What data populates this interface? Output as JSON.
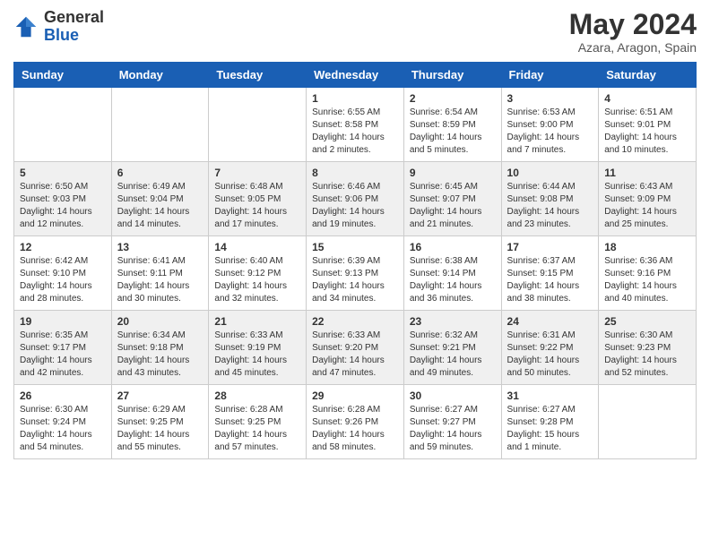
{
  "header": {
    "logo_general": "General",
    "logo_blue": "Blue",
    "month_year": "May 2024",
    "location": "Azara, Aragon, Spain"
  },
  "weekdays": [
    "Sunday",
    "Monday",
    "Tuesday",
    "Wednesday",
    "Thursday",
    "Friday",
    "Saturday"
  ],
  "weeks": [
    {
      "days": [
        {
          "num": "",
          "info": ""
        },
        {
          "num": "",
          "info": ""
        },
        {
          "num": "",
          "info": ""
        },
        {
          "num": "1",
          "info": "Sunrise: 6:55 AM\nSunset: 8:58 PM\nDaylight: 14 hours\nand 2 minutes."
        },
        {
          "num": "2",
          "info": "Sunrise: 6:54 AM\nSunset: 8:59 PM\nDaylight: 14 hours\nand 5 minutes."
        },
        {
          "num": "3",
          "info": "Sunrise: 6:53 AM\nSunset: 9:00 PM\nDaylight: 14 hours\nand 7 minutes."
        },
        {
          "num": "4",
          "info": "Sunrise: 6:51 AM\nSunset: 9:01 PM\nDaylight: 14 hours\nand 10 minutes."
        }
      ]
    },
    {
      "days": [
        {
          "num": "5",
          "info": "Sunrise: 6:50 AM\nSunset: 9:03 PM\nDaylight: 14 hours\nand 12 minutes."
        },
        {
          "num": "6",
          "info": "Sunrise: 6:49 AM\nSunset: 9:04 PM\nDaylight: 14 hours\nand 14 minutes."
        },
        {
          "num": "7",
          "info": "Sunrise: 6:48 AM\nSunset: 9:05 PM\nDaylight: 14 hours\nand 17 minutes."
        },
        {
          "num": "8",
          "info": "Sunrise: 6:46 AM\nSunset: 9:06 PM\nDaylight: 14 hours\nand 19 minutes."
        },
        {
          "num": "9",
          "info": "Sunrise: 6:45 AM\nSunset: 9:07 PM\nDaylight: 14 hours\nand 21 minutes."
        },
        {
          "num": "10",
          "info": "Sunrise: 6:44 AM\nSunset: 9:08 PM\nDaylight: 14 hours\nand 23 minutes."
        },
        {
          "num": "11",
          "info": "Sunrise: 6:43 AM\nSunset: 9:09 PM\nDaylight: 14 hours\nand 25 minutes."
        }
      ]
    },
    {
      "days": [
        {
          "num": "12",
          "info": "Sunrise: 6:42 AM\nSunset: 9:10 PM\nDaylight: 14 hours\nand 28 minutes."
        },
        {
          "num": "13",
          "info": "Sunrise: 6:41 AM\nSunset: 9:11 PM\nDaylight: 14 hours\nand 30 minutes."
        },
        {
          "num": "14",
          "info": "Sunrise: 6:40 AM\nSunset: 9:12 PM\nDaylight: 14 hours\nand 32 minutes."
        },
        {
          "num": "15",
          "info": "Sunrise: 6:39 AM\nSunset: 9:13 PM\nDaylight: 14 hours\nand 34 minutes."
        },
        {
          "num": "16",
          "info": "Sunrise: 6:38 AM\nSunset: 9:14 PM\nDaylight: 14 hours\nand 36 minutes."
        },
        {
          "num": "17",
          "info": "Sunrise: 6:37 AM\nSunset: 9:15 PM\nDaylight: 14 hours\nand 38 minutes."
        },
        {
          "num": "18",
          "info": "Sunrise: 6:36 AM\nSunset: 9:16 PM\nDaylight: 14 hours\nand 40 minutes."
        }
      ]
    },
    {
      "days": [
        {
          "num": "19",
          "info": "Sunrise: 6:35 AM\nSunset: 9:17 PM\nDaylight: 14 hours\nand 42 minutes."
        },
        {
          "num": "20",
          "info": "Sunrise: 6:34 AM\nSunset: 9:18 PM\nDaylight: 14 hours\nand 43 minutes."
        },
        {
          "num": "21",
          "info": "Sunrise: 6:33 AM\nSunset: 9:19 PM\nDaylight: 14 hours\nand 45 minutes."
        },
        {
          "num": "22",
          "info": "Sunrise: 6:33 AM\nSunset: 9:20 PM\nDaylight: 14 hours\nand 47 minutes."
        },
        {
          "num": "23",
          "info": "Sunrise: 6:32 AM\nSunset: 9:21 PM\nDaylight: 14 hours\nand 49 minutes."
        },
        {
          "num": "24",
          "info": "Sunrise: 6:31 AM\nSunset: 9:22 PM\nDaylight: 14 hours\nand 50 minutes."
        },
        {
          "num": "25",
          "info": "Sunrise: 6:30 AM\nSunset: 9:23 PM\nDaylight: 14 hours\nand 52 minutes."
        }
      ]
    },
    {
      "days": [
        {
          "num": "26",
          "info": "Sunrise: 6:30 AM\nSunset: 9:24 PM\nDaylight: 14 hours\nand 54 minutes."
        },
        {
          "num": "27",
          "info": "Sunrise: 6:29 AM\nSunset: 9:25 PM\nDaylight: 14 hours\nand 55 minutes."
        },
        {
          "num": "28",
          "info": "Sunrise: 6:28 AM\nSunset: 9:25 PM\nDaylight: 14 hours\nand 57 minutes."
        },
        {
          "num": "29",
          "info": "Sunrise: 6:28 AM\nSunset: 9:26 PM\nDaylight: 14 hours\nand 58 minutes."
        },
        {
          "num": "30",
          "info": "Sunrise: 6:27 AM\nSunset: 9:27 PM\nDaylight: 14 hours\nand 59 minutes."
        },
        {
          "num": "31",
          "info": "Sunrise: 6:27 AM\nSunset: 9:28 PM\nDaylight: 15 hours\nand 1 minute."
        },
        {
          "num": "",
          "info": ""
        }
      ]
    }
  ]
}
